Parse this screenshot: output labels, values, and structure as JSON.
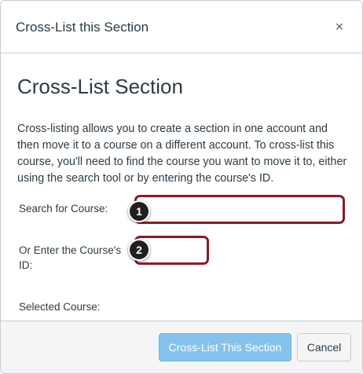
{
  "dialog": {
    "title": "Cross-List this Section",
    "close_symbol": "×"
  },
  "body": {
    "heading": "Cross-List Section",
    "description": "Cross-listing allows you to create a section in one account and then move it to a course on a different account. To cross-list this course, you'll need to find the course you want to move it to, either using the search tool or by entering the course's ID.",
    "search_label": "Search for Course:",
    "search_value": "",
    "id_label": "Or Enter the Course's ID:",
    "id_value": "",
    "selected_label": "Selected Course:"
  },
  "callouts": {
    "one": "1",
    "two": "2"
  },
  "footer": {
    "primary_label": "Cross-List This Section",
    "cancel_label": "Cancel"
  },
  "colors": {
    "highlight_border": "#8b1a28",
    "primary_button": "#86c3ec",
    "footer_bg": "#f5f5f5"
  },
  "icons": {
    "close": "close-icon"
  }
}
